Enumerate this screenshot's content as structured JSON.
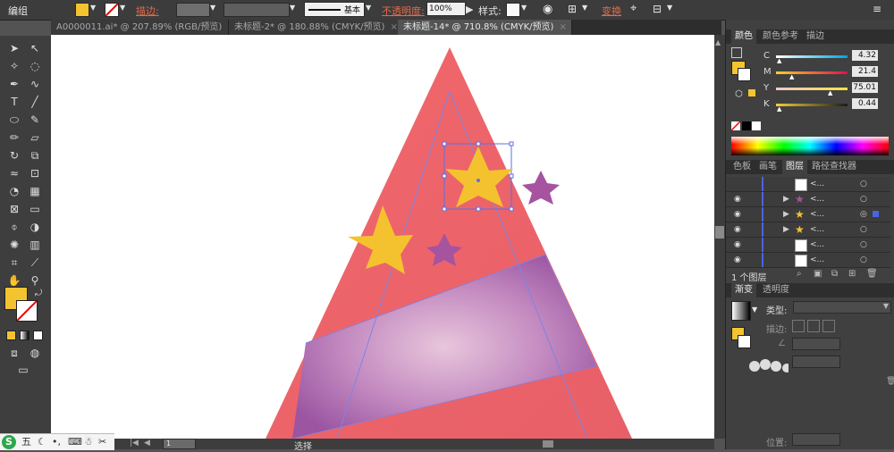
{
  "app": {
    "group_label": "编组"
  },
  "control_bar": {
    "stroke_label": "描边:",
    "stroke_style": "基本",
    "opacity_label": "不透明度:",
    "opacity_value": "100%",
    "style_label": "样式:",
    "transform_label": "变换",
    "accent_color": "#e36a4b",
    "fill_color": "#f4c430"
  },
  "doc_tabs": [
    {
      "label": "A0000011.ai* @ 207.89% (RGB/预览)",
      "active": false
    },
    {
      "label": "未标题-2* @ 180.88% (CMYK/预览)",
      "active": false
    },
    {
      "label": "未标题-14* @ 710.8% (CMYK/预览)",
      "active": true
    }
  ],
  "color_panel": {
    "tabs": [
      "颜色",
      "颜色参考",
      "描边"
    ],
    "channels": [
      {
        "name": "C",
        "value": "4.32",
        "percent": 4.32
      },
      {
        "name": "M",
        "value": "21.4",
        "percent": 21.4
      },
      {
        "name": "Y",
        "value": "75.01",
        "percent": 75.01
      },
      {
        "name": "K",
        "value": "0.44",
        "percent": 0.44
      }
    ]
  },
  "layers_panel": {
    "tabs": [
      "色板",
      "画笔",
      "图层",
      "路径查找器"
    ],
    "rows": [
      {
        "name": "<...",
        "icon": "line-thumb"
      },
      {
        "name": "<...",
        "icon": "star-thumb"
      },
      {
        "name": "<...",
        "icon": "star-thumb-yellow"
      },
      {
        "name": "<...",
        "icon": "star-thumb-yellow"
      },
      {
        "name": "<...",
        "icon": "line-thumb"
      },
      {
        "name": "<...",
        "icon": "line-thumb"
      }
    ],
    "footer": "1 个图层"
  },
  "gradient_panel": {
    "tabs": [
      "渐变",
      "透明度"
    ],
    "type_label": "类型:",
    "stroke_label": "描边:",
    "position_label": "位置:"
  },
  "status_bar": {
    "zoom": "1",
    "tool_label": "选择"
  },
  "ime": {
    "logo": "S",
    "mode": "五"
  },
  "artwork": {
    "triangle_color": "#ee6569",
    "band_color": "#a860a8",
    "star_gold": "#f4c22f",
    "star_purple": "#a653a0"
  }
}
